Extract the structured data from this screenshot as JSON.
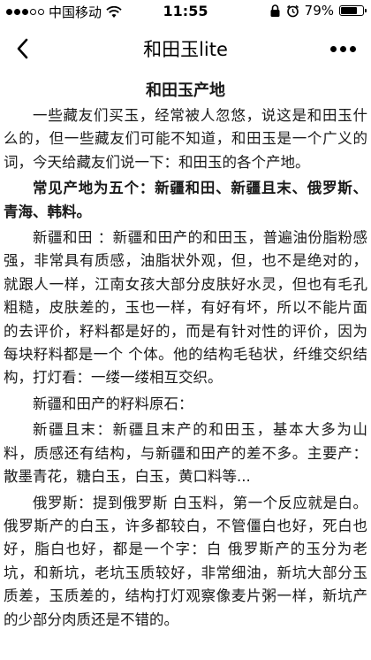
{
  "status_bar": {
    "carrier": "中国移动",
    "time": "11:55",
    "battery_percent_label": "79%",
    "battery_level": 0.79,
    "signal_bars_filled": 3,
    "signal_bars_total": 5
  },
  "nav": {
    "title": "和田玉lite",
    "back_icon": "chevron-left-icon",
    "more_icon": "more-dots-icon"
  },
  "article": {
    "heading": "和田玉产地",
    "paragraphs": [
      "一些藏友们买玉，经常被人忽悠，说这是和田玉什么的，但一些藏友们可能不知道，和田玉是一个广义的词，今天给藏友们说一下：和田玉的各个产地。",
      "常见产地为五个：新疆和田、新疆且末、俄罗斯、青海、韩料。",
      "新疆和田 ：新疆和田产的和田玉，普遍油份脂粉感强，非常具有质感，油脂状外观，但，也不是绝对的，就跟人一样，江南女孩大部分皮肤好水灵，但也有毛孔粗糙，皮肤差的，玉也一样，有好有坏，所以不能片面的去评价，籽料都是好的，而是有针对性的评价，因为每块籽料都是一个 个体。他的结构毛毡状，纤维交织结构，打灯看：一缕一缕相互交织。",
      "新疆和田产的籽料原石：",
      "新疆且末：新疆且末产的和田玉，基本大多为山料，质感还有结构，与新疆和田产的差不多。主要产：散墨青花，糖白玉，白玉，黄口料等...",
      "俄罗斯：提到俄罗斯 白玉料，第一个反应就是白。俄罗斯产的白玉，许多都较白，不管僵白也好，死白也好，脂白也好，都是一个字：白 俄罗斯产的玉分为老坑，和新坑，老坑玉质较好，非常细油，新坑大部分玉质差，玉质差的，结构打灯观察像麦片粥一样，新坑产的少部分肉质还是不错的。"
    ]
  }
}
